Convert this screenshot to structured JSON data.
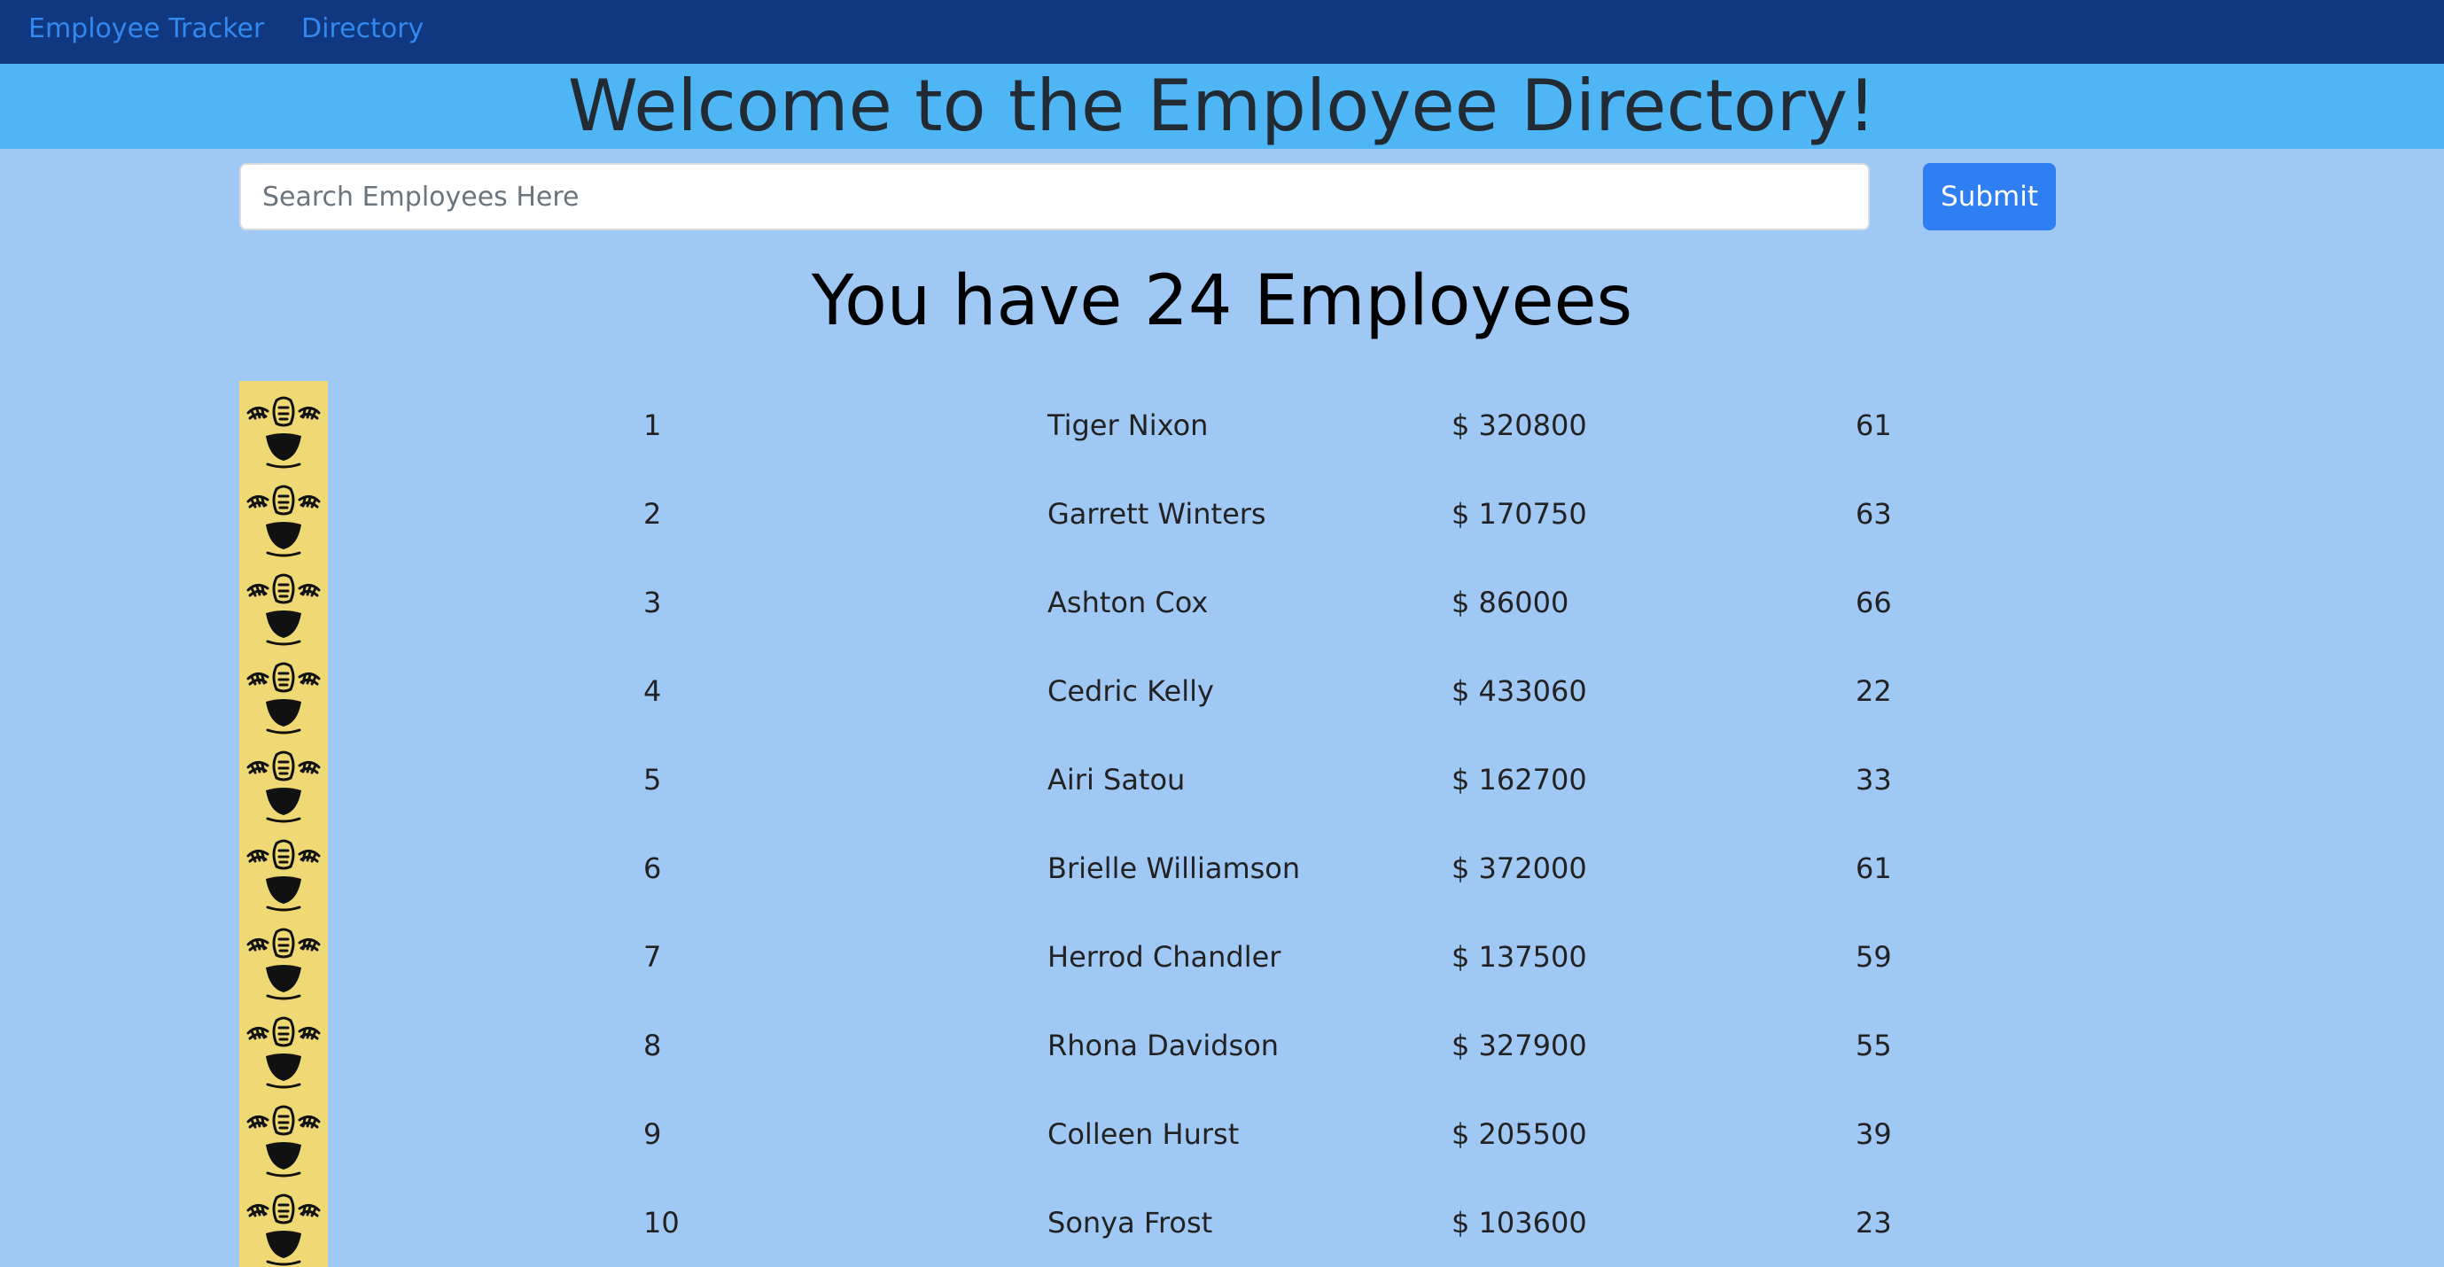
{
  "nav": {
    "brand": "Employee Tracker",
    "directory": "Directory"
  },
  "header": {
    "title": "Welcome to the Employee Directory!"
  },
  "search": {
    "placeholder": "Search Employees Here",
    "value": "",
    "submit_label": "Submit"
  },
  "summary": {
    "heading": "You have 24 Employees"
  },
  "employees": [
    {
      "id": "1",
      "name": "Tiger Nixon",
      "salary": "$ 320800",
      "age": "61"
    },
    {
      "id": "2",
      "name": "Garrett Winters",
      "salary": "$ 170750",
      "age": "63"
    },
    {
      "id": "3",
      "name": "Ashton Cox",
      "salary": "$ 86000",
      "age": "66"
    },
    {
      "id": "4",
      "name": "Cedric Kelly",
      "salary": "$ 433060",
      "age": "22"
    },
    {
      "id": "5",
      "name": "Airi Satou",
      "salary": "$ 162700",
      "age": "33"
    },
    {
      "id": "6",
      "name": "Brielle Williamson",
      "salary": "$ 372000",
      "age": "61"
    },
    {
      "id": "7",
      "name": "Herrod Chandler",
      "salary": "$ 137500",
      "age": "59"
    },
    {
      "id": "8",
      "name": "Rhona Davidson",
      "salary": "$ 327900",
      "age": "55"
    },
    {
      "id": "9",
      "name": "Colleen Hurst",
      "salary": "$ 205500",
      "age": "39"
    },
    {
      "id": "10",
      "name": "Sonya Frost",
      "salary": "$ 103600",
      "age": "23"
    }
  ],
  "icons": {
    "avatar": "laughing-face-icon"
  },
  "colors": {
    "navbar": "#0f3880",
    "header_band": "#4fb6f6",
    "page_background": "#a0c8f4",
    "accent": "#2f7ff2",
    "avatar_background": "#efd975"
  }
}
